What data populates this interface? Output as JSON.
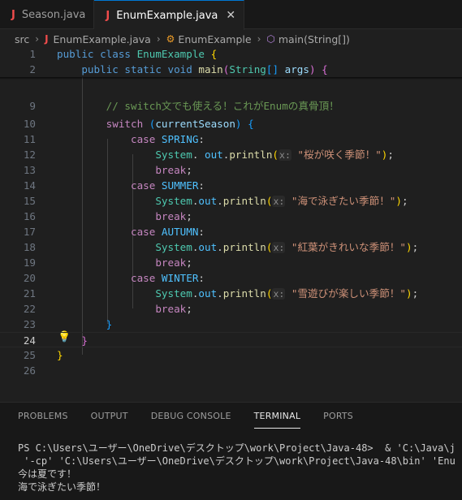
{
  "tabs": [
    {
      "icon": "J",
      "label": "Season.java",
      "active": false
    },
    {
      "icon": "J",
      "label": "EnumExample.java",
      "active": true,
      "close": "✕"
    }
  ],
  "breadcrumb": {
    "folder": "src",
    "file": "EnumExample.java",
    "class_name": "EnumExample",
    "method": "main(String[])"
  },
  "editor": {
    "current_line": 24,
    "lines": [
      {
        "n": "1",
        "segments": [
          [
            "kw",
            "public "
          ],
          [
            "kw",
            "class "
          ],
          [
            "ty",
            "EnumExample "
          ],
          [
            "br1",
            "{"
          ]
        ]
      },
      {
        "n": "2",
        "segments": [
          [
            "",
            "    "
          ],
          [
            "kw",
            "public "
          ],
          [
            "kw",
            "static "
          ],
          [
            "kw",
            "void "
          ],
          [
            "fn",
            "main"
          ],
          [
            "br2",
            "("
          ],
          [
            "ty",
            "String"
          ],
          [
            "br3",
            "[]"
          ],
          [
            "var",
            " args"
          ],
          [
            "br2",
            ")"
          ],
          [
            "",
            " "
          ],
          [
            "br2",
            "{"
          ]
        ]
      },
      {
        "n": "9",
        "segments": [
          [
            "",
            "        "
          ],
          [
            "cm",
            "// switch文でも使える！これがEnumの真骨頂！"
          ]
        ]
      },
      {
        "n": "10",
        "segments": [
          [
            "",
            "        "
          ],
          [
            "kw2",
            "switch "
          ],
          [
            "br3",
            "("
          ],
          [
            "var",
            "currentSeason"
          ],
          [
            "br3",
            ")"
          ],
          [
            "",
            " "
          ],
          [
            "br3",
            "{"
          ]
        ]
      },
      {
        "n": "11",
        "segments": [
          [
            "",
            "            "
          ],
          [
            "kw2",
            "case "
          ],
          [
            "en",
            "SPRING"
          ],
          [
            "",
            ":"
          ]
        ]
      },
      {
        "n": "12",
        "segments": [
          [
            "",
            "                "
          ],
          [
            "ty",
            "System"
          ],
          [
            "",
            ". "
          ],
          [
            "en",
            "out"
          ],
          [
            "",
            "."
          ],
          [
            "fn",
            "println"
          ],
          [
            "br1",
            "("
          ],
          [
            "hint",
            "x:"
          ],
          [
            "",
            ""
          ],
          [
            "str",
            " \"桜が咲く季節！\""
          ],
          [
            "br1",
            ")"
          ],
          [
            "",
            ";"
          ]
        ]
      },
      {
        "n": "13",
        "segments": [
          [
            "",
            "                "
          ],
          [
            "kw2",
            "break"
          ],
          [
            "",
            ";"
          ]
        ]
      },
      {
        "n": "14",
        "segments": [
          [
            "",
            "            "
          ],
          [
            "kw2",
            "case "
          ],
          [
            "en",
            "SUMMER"
          ],
          [
            "",
            ":"
          ]
        ]
      },
      {
        "n": "15",
        "segments": [
          [
            "",
            "                "
          ],
          [
            "ty",
            "System"
          ],
          [
            "",
            "."
          ],
          [
            "en",
            "out"
          ],
          [
            "",
            "."
          ],
          [
            "fn",
            "println"
          ],
          [
            "br1",
            "("
          ],
          [
            "hint",
            "x:"
          ],
          [
            "str",
            " \"海で泳ぎたい季節！\""
          ],
          [
            "br1",
            ")"
          ],
          [
            "",
            ";"
          ]
        ]
      },
      {
        "n": "16",
        "segments": [
          [
            "",
            "                "
          ],
          [
            "kw2",
            "break"
          ],
          [
            "",
            ";"
          ]
        ]
      },
      {
        "n": "17",
        "segments": [
          [
            "",
            "            "
          ],
          [
            "kw2",
            "case "
          ],
          [
            "en",
            "AUTUMN"
          ],
          [
            "",
            ":"
          ]
        ]
      },
      {
        "n": "18",
        "segments": [
          [
            "",
            "                "
          ],
          [
            "ty",
            "System"
          ],
          [
            "",
            "."
          ],
          [
            "en",
            "out"
          ],
          [
            "",
            "."
          ],
          [
            "fn",
            "println"
          ],
          [
            "br1",
            "("
          ],
          [
            "hint",
            "x:"
          ],
          [
            "str",
            " \"紅葉がきれいな季節！\""
          ],
          [
            "br1",
            ")"
          ],
          [
            "",
            ";"
          ]
        ]
      },
      {
        "n": "19",
        "segments": [
          [
            "",
            "                "
          ],
          [
            "kw2",
            "break"
          ],
          [
            "",
            ";"
          ]
        ]
      },
      {
        "n": "20",
        "segments": [
          [
            "",
            "            "
          ],
          [
            "kw2",
            "case "
          ],
          [
            "en",
            "WINTER"
          ],
          [
            "",
            ":"
          ]
        ]
      },
      {
        "n": "21",
        "segments": [
          [
            "",
            "                "
          ],
          [
            "ty",
            "System"
          ],
          [
            "",
            "."
          ],
          [
            "en",
            "out"
          ],
          [
            "",
            "."
          ],
          [
            "fn",
            "println"
          ],
          [
            "br1",
            "("
          ],
          [
            "hint",
            "x:"
          ],
          [
            "str",
            " \"雪遊びが楽しい季節！\""
          ],
          [
            "br1",
            ")"
          ],
          [
            "",
            ";"
          ]
        ]
      },
      {
        "n": "22",
        "segments": [
          [
            "",
            "                "
          ],
          [
            "kw2",
            "break"
          ],
          [
            "",
            ";"
          ]
        ]
      },
      {
        "n": "23",
        "segments": [
          [
            "",
            "        "
          ],
          [
            "br3",
            "}"
          ]
        ]
      },
      {
        "n": "24",
        "segments": [
          [
            "",
            "    "
          ],
          [
            "br2",
            "}"
          ]
        ]
      },
      {
        "n": "25",
        "segments": [
          [
            "br1",
            "}"
          ]
        ]
      },
      {
        "n": "26",
        "segments": []
      }
    ]
  },
  "panel": {
    "tabs": [
      "PROBLEMS",
      "OUTPUT",
      "DEBUG CONSOLE",
      "TERMINAL",
      "PORTS"
    ],
    "active_tab": "TERMINAL",
    "terminal_lines": [
      "PS C:\\Users\\ユーザー\\OneDrive\\デスクトップ\\work\\Project\\Java-48>  & 'C:\\Java\\j",
      " '-cp' 'C:\\Users\\ユーザー\\OneDrive\\デスクトップ\\work\\Project\\Java-48\\bin' 'Enu",
      "今は夏です！",
      "海で泳ぎたい季節！"
    ]
  },
  "colors": {
    "accent": "#0078d4",
    "java_icon": "#f14c4c",
    "lightbulb": "#ffcc00"
  }
}
